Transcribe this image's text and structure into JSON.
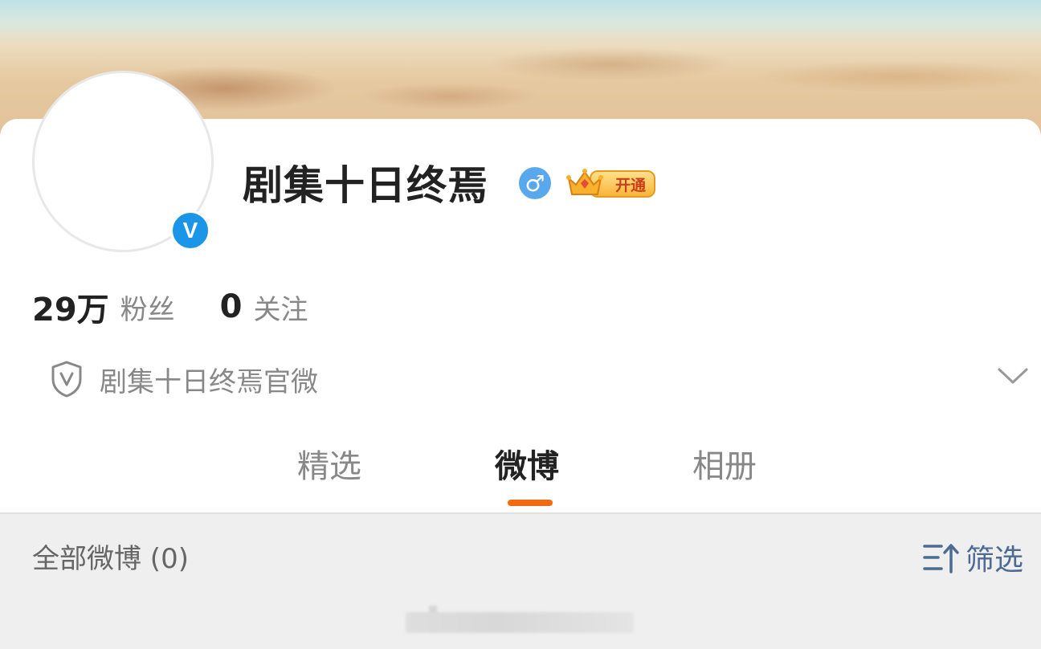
{
  "profile": {
    "name": "剧集十日终焉",
    "gender_symbol": "♂",
    "verified_mark": "V",
    "vip_label": "开通"
  },
  "stats": {
    "followers_count": "29万",
    "followers_label": "粉丝",
    "following_count": "0",
    "following_label": "关注"
  },
  "bio": {
    "text": "剧集十日终焉官微",
    "shield_letter": "V"
  },
  "tabs": [
    {
      "label": "精选"
    },
    {
      "label": "微博",
      "active": true
    },
    {
      "label": "相册"
    }
  ],
  "feed": {
    "header": "全部微博 (0)",
    "filter_label": "筛选"
  },
  "colors": {
    "accent": "#f16a12",
    "verified_blue": "#1a95e8",
    "gender_blue": "#5aa8ec",
    "filter_blue": "#4d6a93"
  }
}
